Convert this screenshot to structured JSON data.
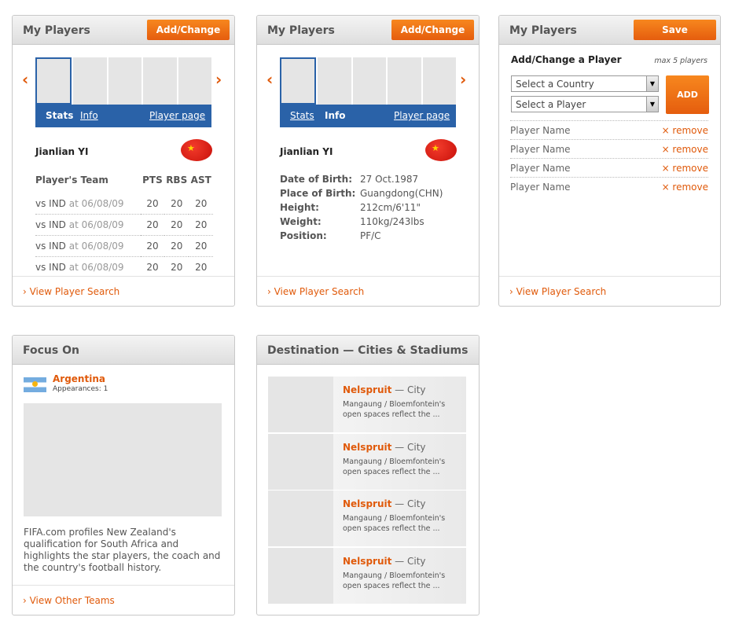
{
  "widget1": {
    "title": "My Players",
    "button": "Add/Change",
    "tabs": {
      "stats": "Stats",
      "info": "Info",
      "player_page": "Player page"
    },
    "player_name": "Jianlian YI",
    "table": {
      "headers": [
        "Player's Team",
        "PTS",
        "RBS",
        "AST"
      ],
      "rows": [
        {
          "match": "vs IND",
          "date": "at 06/08/09",
          "pts": "20",
          "rbs": "20",
          "ast": "20"
        },
        {
          "match": "vs IND",
          "date": "at 06/08/09",
          "pts": "20",
          "rbs": "20",
          "ast": "20"
        },
        {
          "match": "vs IND",
          "date": "at 06/08/09",
          "pts": "20",
          "rbs": "20",
          "ast": "20"
        },
        {
          "match": "vs IND",
          "date": "at 06/08/09",
          "pts": "20",
          "rbs": "20",
          "ast": "20"
        }
      ]
    },
    "footer_link": "› View Player Search"
  },
  "widget2": {
    "title": "My Players",
    "button": "Add/Change",
    "tabs": {
      "stats": "Stats",
      "info": "Info",
      "player_page": "Player page"
    },
    "player_name": "Jianlian YI",
    "info": [
      {
        "label": "Date of Birth:",
        "value": "27 Oct.1987"
      },
      {
        "label": "Place of Birth:",
        "value": "Guangdong(CHN)"
      },
      {
        "label": "Height:",
        "value": "212cm/6'11\""
      },
      {
        "label": "Weight:",
        "value": "110kg/243lbs"
      },
      {
        "label": "Position:",
        "value": "PF/C"
      }
    ],
    "footer_link": "› View Player Search"
  },
  "widget3": {
    "title": "My Players",
    "button": "Save",
    "subtitle": "Add/Change a Player",
    "max_note": "max 5 players",
    "country_select": "Select a Country",
    "player_select": "Select a Player",
    "add_button": "ADD",
    "players": [
      {
        "name": "Player Name",
        "remove": "× remove"
      },
      {
        "name": "Player Name",
        "remove": "× remove"
      },
      {
        "name": "Player Name",
        "remove": "× remove"
      },
      {
        "name": "Player Name",
        "remove": "× remove"
      }
    ],
    "footer_link": "› View Player Search"
  },
  "widget4": {
    "title": "Focus On",
    "country": "Argentina",
    "appearances": "Appearances: 1",
    "description": "FIFA.com profiles New Zealand's qualification for South Africa and highlights the star players, the coach and the country's football history.",
    "footer_link": "› View Other Teams"
  },
  "widget5": {
    "title": "Destination — Cities & Stadiums",
    "items": [
      {
        "name": "Nelspruit",
        "type": "— City",
        "desc": "Mangaung / Bloemfontein's open spaces reflect the ..."
      },
      {
        "name": "Nelspruit",
        "type": "— City",
        "desc": "Mangaung / Bloemfontein's open spaces reflect the ..."
      },
      {
        "name": "Nelspruit",
        "type": "— City",
        "desc": "Mangaung / Bloemfontein's open spaces reflect the ..."
      },
      {
        "name": "Nelspruit",
        "type": "— City",
        "desc": "Mangaung / Bloemfontein's open spaces reflect the ..."
      }
    ]
  },
  "icons": {
    "prev": "chevron-left-icon",
    "next": "chevron-right-icon",
    "flag_china": "china-flag-icon",
    "flag_argentina": "argentina-flag-icon",
    "dropdown": "caret-down-icon"
  },
  "colors": {
    "accent": "#e05a0b",
    "tab_blue": "#2a62a8"
  }
}
